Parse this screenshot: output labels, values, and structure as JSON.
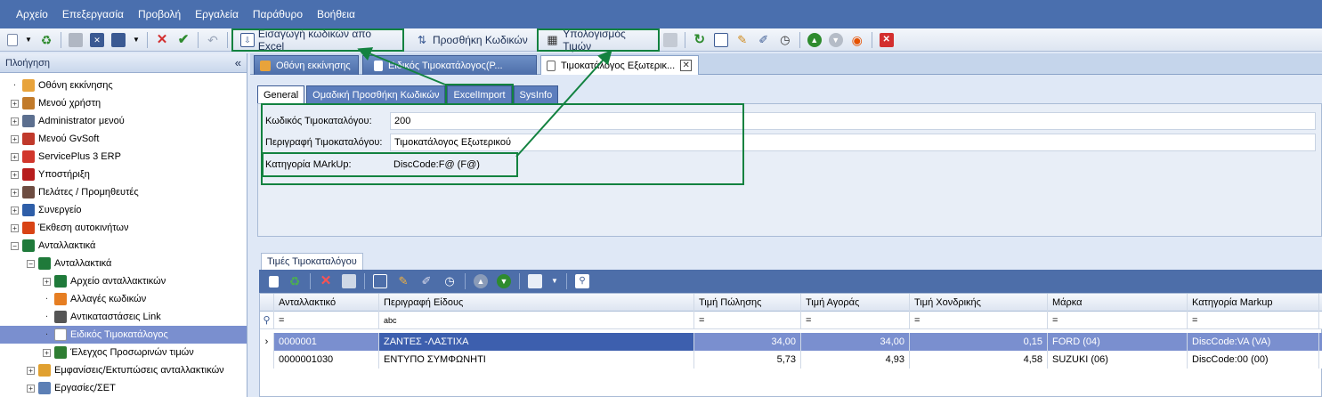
{
  "menu": [
    "Αρχείο",
    "Επεξεργασία",
    "Προβολή",
    "Εργαλεία",
    "Παράθυρο",
    "Βοήθεια"
  ],
  "toolbar": {
    "import_label": "Εισαγωγή κωδικών απο Excel",
    "add_codes_label": "Προσθήκη Κωδικών",
    "calc_prices_label": "Υπολογισμός Τιμών"
  },
  "sidebar": {
    "title": "Πλοήγηση",
    "collapse": "«",
    "items": [
      {
        "label": "Οθόνη εκκίνησης",
        "icon": "home-icon",
        "color": "#e8a33b",
        "indent": 1,
        "exp": ""
      },
      {
        "label": "Μενού χρήστη",
        "icon": "user-icon",
        "color": "#c17a2a",
        "indent": 1,
        "exp": "+"
      },
      {
        "label": "Administrator μενού",
        "icon": "admin-icon",
        "color": "#5c6f8f",
        "indent": 1,
        "exp": "+"
      },
      {
        "label": "Μενού GvSoft",
        "icon": "gvsoft-icon",
        "color": "#c0392b",
        "indent": 1,
        "exp": "+"
      },
      {
        "label": "ServicePlus 3 ERP",
        "icon": "erp-icon",
        "color": "#d1362c",
        "indent": 1,
        "exp": "+"
      },
      {
        "label": "Υποστήριξη",
        "icon": "phone-icon",
        "color": "#b71c1c",
        "indent": 1,
        "exp": "+"
      },
      {
        "label": "Πελάτες / Προμηθευτές",
        "icon": "people-icon",
        "color": "#6d4c41",
        "indent": 1,
        "exp": "+"
      },
      {
        "label": "Συνεργείο",
        "icon": "tools-icon",
        "color": "#2e5ea8",
        "indent": 1,
        "exp": "+"
      },
      {
        "label": "Έκθεση αυτοκινήτων",
        "icon": "car-icon",
        "color": "#d84315",
        "indent": 1,
        "exp": "+"
      },
      {
        "label": "Ανταλλακτικά",
        "icon": "wrench-icon",
        "color": "#1f7a3a",
        "indent": 1,
        "exp": "−"
      },
      {
        "label": "Ανταλλακτικά",
        "icon": "wrench-icon",
        "color": "#1f7a3a",
        "indent": 2,
        "exp": "−"
      },
      {
        "label": "Αρχείο ανταλλακτικών",
        "icon": "wrench-icon",
        "color": "#1f7a3a",
        "indent": 3,
        "exp": "+"
      },
      {
        "label": "Αλλαγές κωδικών",
        "icon": "compass-icon",
        "color": "#e67e22",
        "indent": 3,
        "exp": ""
      },
      {
        "label": "Αντικαταστάσεις Link",
        "icon": "link-icon",
        "color": "#555555",
        "indent": 3,
        "exp": ""
      },
      {
        "label": "Ειδικός Τιμοκατάλογος",
        "icon": "document-icon",
        "color": "#ffffff",
        "indent": 3,
        "exp": "",
        "selected": true
      },
      {
        "label": "Έλεγχος Προσωρινών τιμών",
        "icon": "check-icon",
        "color": "#2e7d32",
        "indent": 3,
        "exp": "+"
      },
      {
        "label": "Εμφανίσεις/Εκτυπώσεις ανταλλακτικών",
        "icon": "folder-icon",
        "color": "#e0a030",
        "indent": 2,
        "exp": "+"
      },
      {
        "label": "Εργασίες/ΣΕΤ",
        "icon": "folder-icon",
        "color": "#5c7fb5",
        "indent": 2,
        "exp": "+"
      }
    ]
  },
  "doc_tabs": [
    {
      "label": "Οθόνη εκκίνησης"
    },
    {
      "label": "Ειδικός Τιμοκατάλογος(Ρ..."
    },
    {
      "label": "Τιμοκατάλογος Εξωτερικ..."
    }
  ],
  "inner_tabs": [
    "General",
    "Ομαδική Προσθήκη Κωδικών",
    "ExcelImport",
    "SysInfo"
  ],
  "form": {
    "code_label": "Κωδικός Τιμοκαταλόγου:",
    "code_value": "200",
    "desc_label": "Περιγραφή Τιμοκαταλόγου:",
    "desc_value": "Τιμοκατάλογος Εξωτερικού",
    "markup_label": "Κατηγορία MArkUp:",
    "markup_value": "DiscCode:F@ (F@)"
  },
  "grid": {
    "tab_label": "Τιμές Τιμοκαταλόγου",
    "columns": [
      "Ανταλλακτικό",
      "Περιγραφή Είδους",
      "Τιμή Πώλησης",
      "Τιμή Αγοράς",
      "Τιμή Χονδρικής",
      "Μάρκα",
      "Κατηγορία Markup"
    ],
    "filter": [
      "=",
      "abc",
      "=",
      "=",
      "=",
      "=",
      "="
    ],
    "rows": [
      [
        "0000001",
        "ΖΑΝΤΕΣ -ΛΑΣΤΙΧΑ",
        "34,00",
        "34,00",
        "0,15",
        "FORD (04)",
        "DiscCode:VA (VA)"
      ],
      [
        "0000001030",
        "ΕΝΤΥΠΟ ΣΥΜΦΩΝΗΤΙ",
        "5,73",
        "4,93",
        "4,58",
        "SUZUKI (06)",
        "DiscCode:00 (00)"
      ]
    ]
  },
  "colors": {
    "highlight": "#138240",
    "accent": "#4d6ea9",
    "selection": "#7a8fcf"
  }
}
